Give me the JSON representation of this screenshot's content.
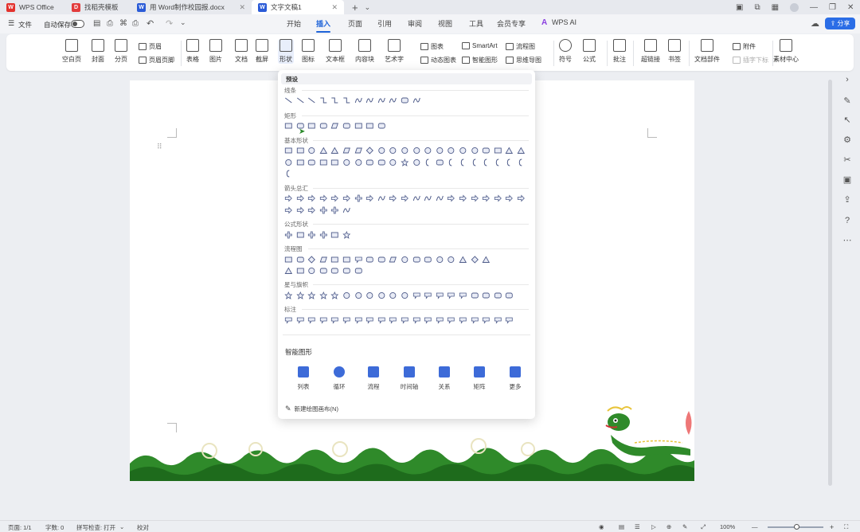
{
  "titlebar": {
    "tabs": [
      {
        "label": "WPS Office",
        "icon": "wps-logo"
      },
      {
        "label": "找稻壳模板",
        "icon": "docer-icon"
      },
      {
        "label": "用 Word制作校园报.docx",
        "icon": "word-icon"
      },
      {
        "label": "文字文稿1",
        "icon": "word-icon"
      }
    ],
    "new_tab": "+",
    "dropdown": "⌄"
  },
  "menubar": {
    "file_label": "文件",
    "autosave_label": "自动保存",
    "tabs": [
      "开始",
      "插入",
      "页面",
      "引用",
      "审阅",
      "视图",
      "工具",
      "会员专享",
      "WPS AI"
    ],
    "active_tab": "插入",
    "share_label": "分享"
  },
  "ribbon": {
    "blank_page": "空白页",
    "cover": "封面",
    "page_break": "分页",
    "header": "页眉",
    "header_footer": "页眉页脚",
    "table": "表格",
    "picture": "图片",
    "document": "文档",
    "screenshot": "截屏",
    "shapes": "形状",
    "icons": "图标",
    "textbox": "文本框",
    "content_block": "内容块",
    "wordart": "艺术字",
    "chart": "图表",
    "smartart": "SmartArt",
    "flowchart": "流程图",
    "dynamic_chart": "动态图表",
    "smart_graphic": "智能图形",
    "mindmap": "思维导图",
    "symbol": "符号",
    "formula": "公式",
    "comment": "批注",
    "hyperlink": "超链接",
    "bookmark": "书签",
    "doc_parts": "文档部件",
    "attachment": "附件",
    "add_subscript": "插字下标",
    "material_center": "素材中心"
  },
  "shapes_panel": {
    "preset_label": "预设",
    "sections": {
      "lines": "线条",
      "rectangles": "矩形",
      "basic": "基本形状",
      "arrows": "箭头总汇",
      "formula": "公式形状",
      "flowchart": "流程图",
      "stars": "星与旗帜",
      "callouts": "标注"
    },
    "smart_graphic_label": "智能图形",
    "smart_items": [
      "列表",
      "循环",
      "流程",
      "时间轴",
      "关系",
      "矩阵",
      "更多"
    ],
    "new_canvas": "新建绘图画布(N)"
  },
  "statusbar": {
    "page": "页面: 1/1",
    "words": "字数: 0",
    "spellcheck": "拼写检查: 打开",
    "proofread": "校对",
    "zoom": "100%"
  },
  "colors": {
    "accent": "#1e63d8",
    "green_wave": "#2f8a2a"
  }
}
